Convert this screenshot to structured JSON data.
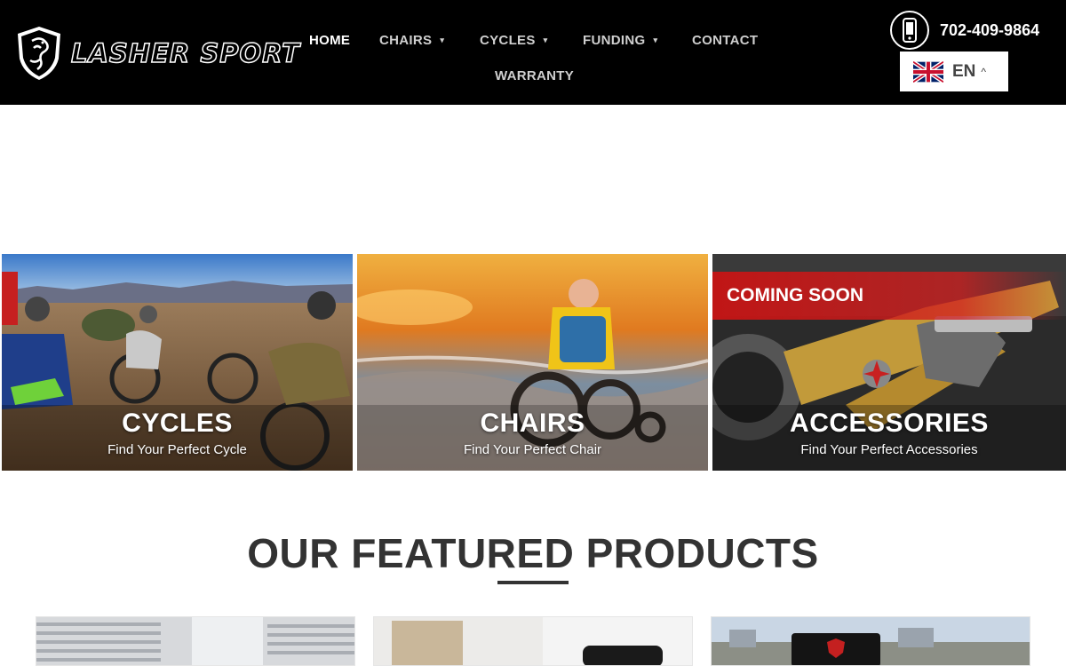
{
  "brand": {
    "name": "LASHER SPORT"
  },
  "nav": {
    "items": [
      {
        "label": "HOME",
        "active": true
      },
      {
        "label": "CHAIRS",
        "caret": "▾"
      },
      {
        "label": "CYCLES",
        "caret": "▾"
      },
      {
        "label": "FUNDING",
        "caret": "▾"
      },
      {
        "label": "CONTACT"
      },
      {
        "label": "WARRANTY"
      }
    ]
  },
  "contact": {
    "phone": "702-409-9864",
    "icon": "mobile-phone-icon"
  },
  "language": {
    "code": "EN",
    "flag": "uk-flag-icon",
    "chevron": "^"
  },
  "tiles": [
    {
      "title": "CYCLES",
      "subtitle": "Find Your Perfect Cycle"
    },
    {
      "title": "CHAIRS",
      "subtitle": "Find Your Perfect Chair"
    },
    {
      "title": "ACCESSORIES",
      "subtitle": "Find Your Perfect Accessories",
      "badge": "COMING SOON"
    }
  ],
  "featured": {
    "title": "OUR FEATURED PRODUCTS"
  },
  "colors": {
    "header_bg": "#000000",
    "accent_red": "#d42020",
    "heading": "#333333"
  }
}
